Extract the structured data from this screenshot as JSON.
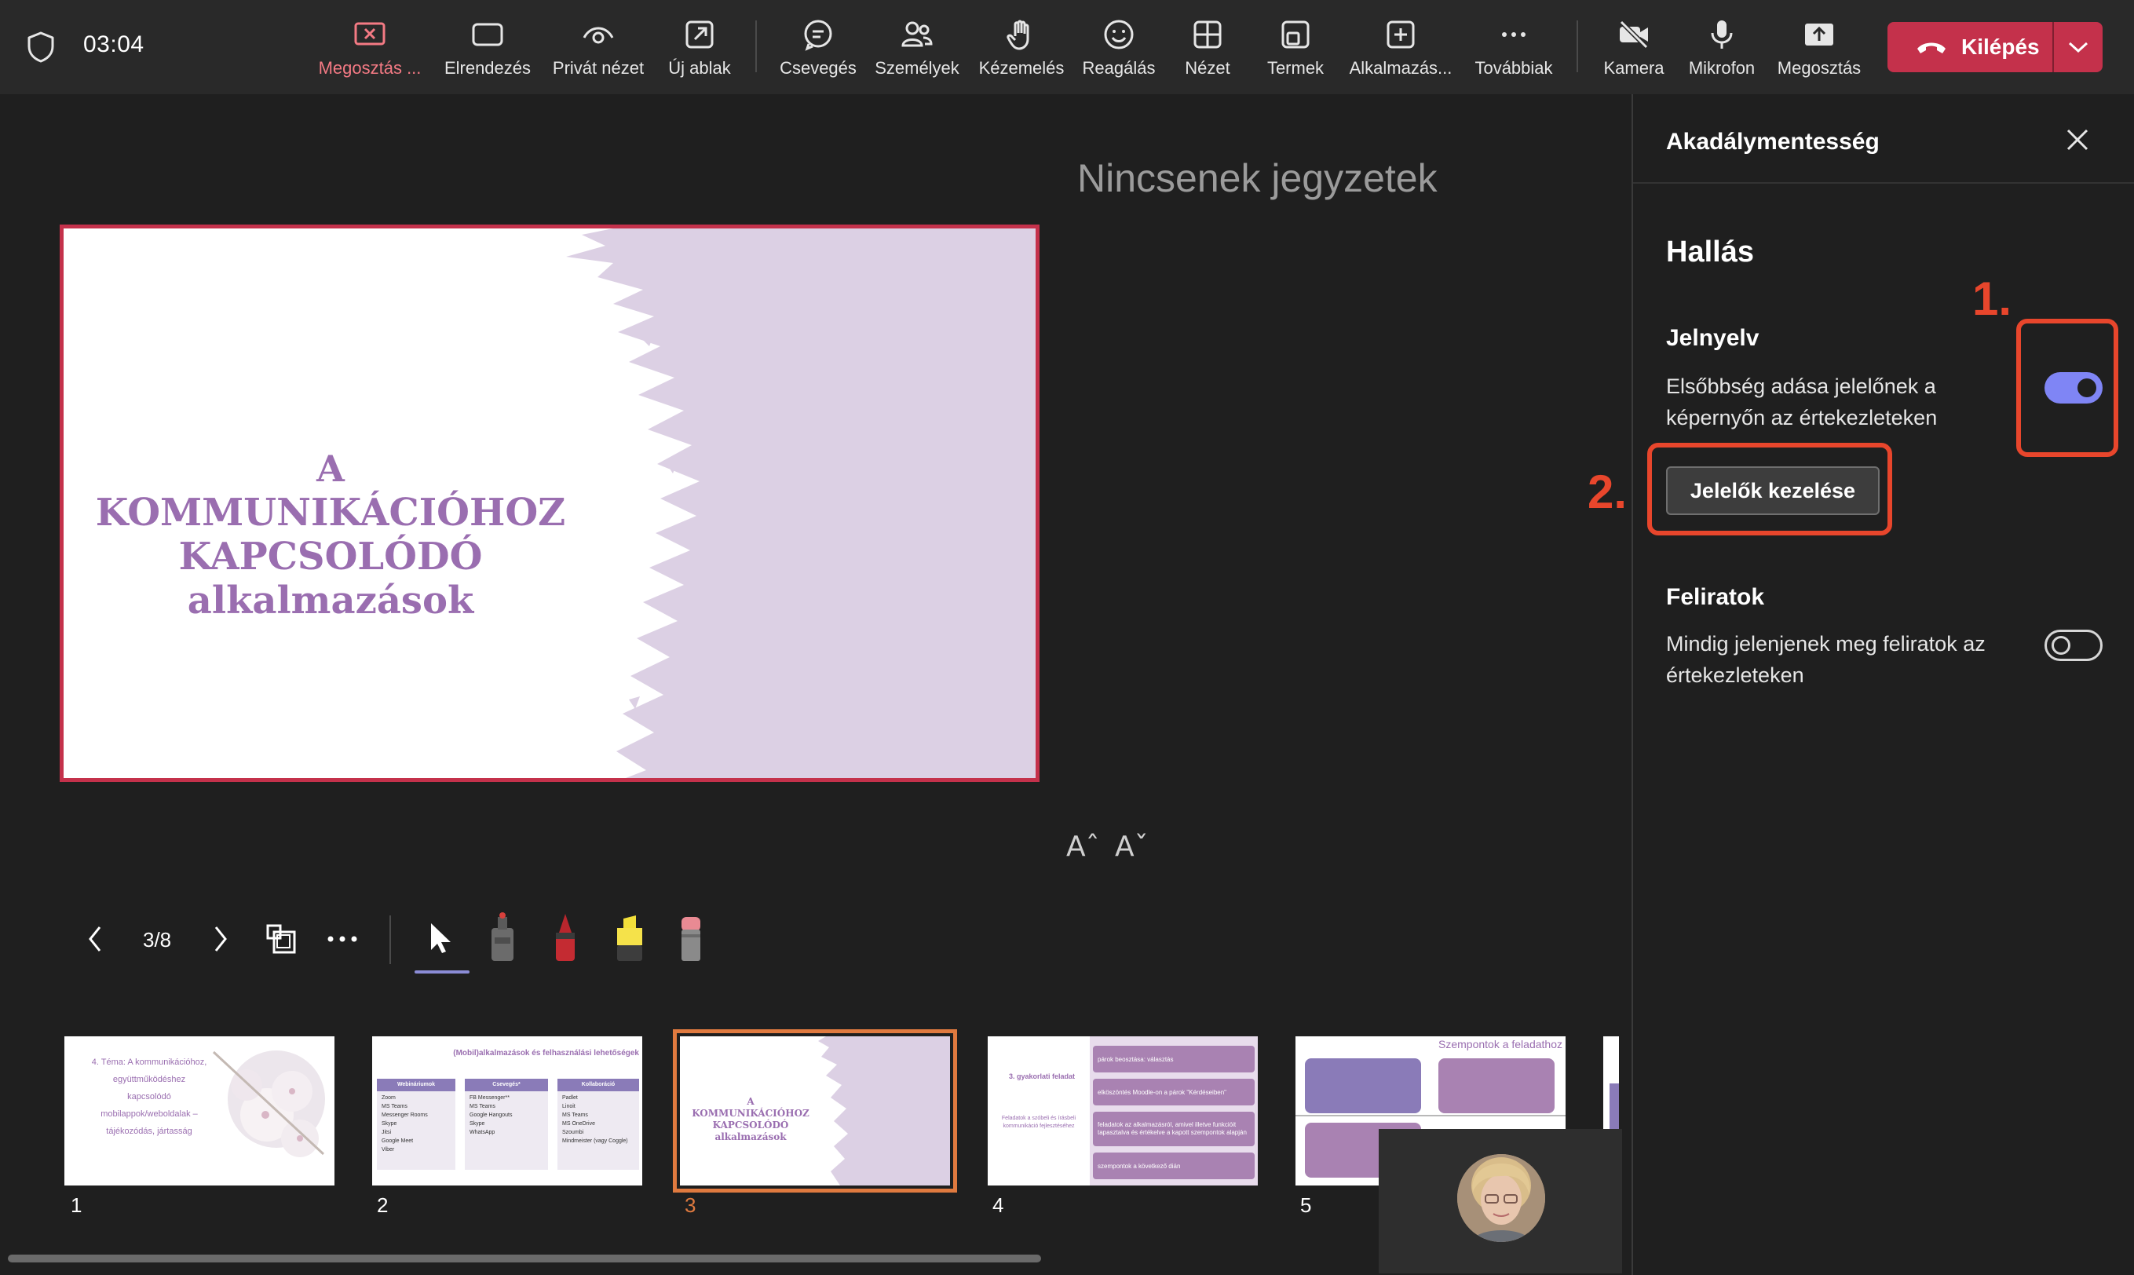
{
  "topbar": {
    "timer": "03:04",
    "items": [
      {
        "label": "Megosztás ...",
        "icon": "stop-share-icon"
      },
      {
        "label": "Elrendezés",
        "icon": "layout-icon"
      },
      {
        "label": "Privát nézet",
        "icon": "private-view-icon"
      },
      {
        "label": "Új ablak",
        "icon": "new-window-icon"
      },
      {
        "label": "Csevegés",
        "icon": "chat-icon"
      },
      {
        "label": "Személyek",
        "icon": "people-icon"
      },
      {
        "label": "Kézemelés",
        "icon": "raise-hand-icon"
      },
      {
        "label": "Reagálás",
        "icon": "react-icon"
      },
      {
        "label": "Nézet",
        "icon": "view-icon"
      },
      {
        "label": "Termek",
        "icon": "rooms-icon"
      },
      {
        "label": "Alkalmazás...",
        "icon": "apps-icon"
      },
      {
        "label": "Továbbiak",
        "icon": "more-icon"
      },
      {
        "label": "Kamera",
        "icon": "camera-off-icon"
      },
      {
        "label": "Mikrofon",
        "icon": "microphone-icon"
      },
      {
        "label": "Megosztás",
        "icon": "share-icon"
      }
    ],
    "leave_label": "Kilépés",
    "accent_leave": "#c4314b",
    "accent_active": "#f47a84"
  },
  "presenter": {
    "notes_placeholder": "Nincsenek jegyzetek",
    "slide_title_lines": [
      "A",
      "KOMMUNIKÁCIÓHOZ",
      "KAPCSOLÓDÓ",
      "alkalmazások"
    ],
    "font_increase": "Aˆ",
    "font_decrease": "Aˇ",
    "page_indicator": "3/8",
    "thumbnails": [
      {
        "number": "1",
        "lines": [
          "4. Téma: A kommunikációhoz,",
          "együttműködéshez",
          "kapcsolódó",
          "mobilappok/weboldalak –",
          "tájékozódás, jártasság"
        ]
      },
      {
        "number": "2",
        "heading": "(Mobil)alkalmazások és felhasználási lehetőségek",
        "columns": [
          {
            "head": "Webináriumok",
            "items": [
              "Zoom",
              "MS Teams",
              "Messenger Rooms",
              "Skype",
              "Jitsi",
              "Google Meet",
              "Viber"
            ]
          },
          {
            "head": "Csevegés*",
            "items": [
              "FB Messenger**",
              "MS Teams",
              "Google Hangouts",
              "Skype",
              "WhatsApp"
            ]
          },
          {
            "head": "Kollaboráció",
            "items": [
              "Padlet",
              "Linoit",
              "MS Teams",
              "MS OneDrive",
              "Szoumbi",
              "Mindmeister (vagy Coggle)"
            ]
          }
        ]
      },
      {
        "number": "3",
        "lines": [
          "A",
          "KOMMUNIKÁCIÓHOZ",
          "KAPCSOLÓDÓ",
          "alkalmazások"
        ]
      },
      {
        "number": "4",
        "heading": "3. gyakorlati feladat",
        "pills": [
          "párok beosztása: választás",
          "elköszöntés Moodle-on a párok \"Kérdéseiben\"",
          "feladatok az alkalmazásról, amivel illetve funkcióit tapasztalva és értékelve a kapott szempontok alapján",
          "szempontok a következő dián"
        ],
        "left_note": "Feladatok a szóbeli és írásbeli kommunikáció fejlesztéséhez"
      },
      {
        "number": "5",
        "heading": "Szempontok a feladathoz"
      }
    ],
    "selected_thumbnail": "3"
  },
  "panel": {
    "title": "Akadálymentesség",
    "section_title": "Hallás",
    "sign_language": {
      "title": "Jelnyelv",
      "description": "Elsőbbség adása jelelőnek a képernyőn az értekezleteken",
      "toggle_on": true,
      "manage_button": "Jelelők kezelése"
    },
    "captions": {
      "title": "Feliratok",
      "description": "Mindig jelenjenek meg feliratok az értekezleteken",
      "toggle_on": false
    },
    "toggle_accent": "#7f85f5"
  },
  "annotations": {
    "step1": "1.",
    "step2": "2.",
    "color": "#e8462c"
  }
}
